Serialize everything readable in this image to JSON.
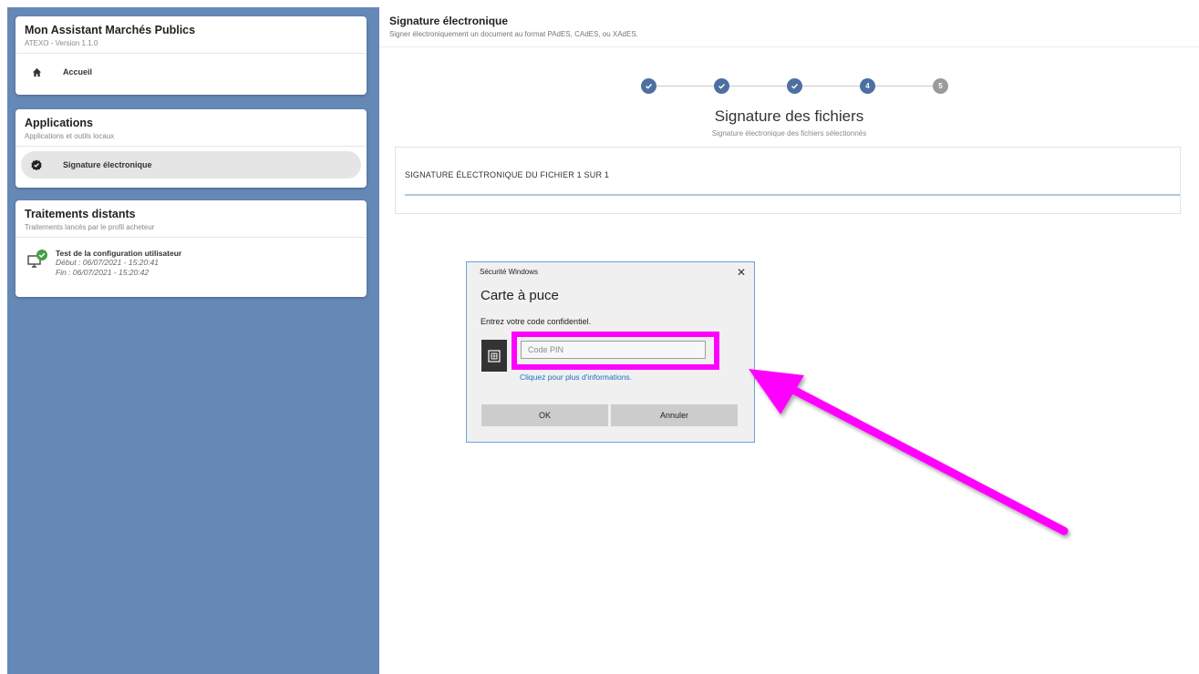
{
  "app": {
    "title": "Mon Assistant Marchés Publics",
    "version": "ATEXO - Version 1.1.0",
    "home_label": "Accueil"
  },
  "applications": {
    "title": "Applications",
    "subtitle": "Applications et outils locaux",
    "items": [
      {
        "label": "Signature électronique",
        "icon": "check-badge-icon",
        "active": true
      }
    ]
  },
  "remote": {
    "title": "Traitements distants",
    "subtitle": "Traitements lancés par le profil acheteur",
    "tasks": [
      {
        "name": "Test de la configuration utilisateur",
        "start": "Début : 06/07/2021 - 15:20:41",
        "end": "Fin : 06/07/2021 - 15:20:42",
        "icon": "monitor-check-icon"
      }
    ]
  },
  "main": {
    "title": "Signature électronique",
    "subtitle": "Signer électroniquement un document au format PAdES, CAdES, ou XAdES.",
    "steps": [
      {
        "state": "done",
        "label": ""
      },
      {
        "state": "done",
        "label": ""
      },
      {
        "state": "done",
        "label": ""
      },
      {
        "state": "current",
        "label": "4"
      },
      {
        "state": "todo",
        "label": "5"
      }
    ],
    "section_title": "Signature des fichiers",
    "section_subtitle": "Signature électronique des fichiers sélectionnés",
    "progress_label": "SIGNATURE ÉLECTRONIQUE DU FICHIER 1 SUR 1",
    "progress_fraction": 1.0
  },
  "dialog": {
    "caption": "Sécurité Windows",
    "title": "Carte à puce",
    "prompt": "Entrez votre code confidentiel.",
    "pin_placeholder": "Code PIN",
    "link": "Cliquez pour plus d'informations.",
    "ok_label": "OK",
    "cancel_label": "Annuler",
    "close_glyph": "✕"
  },
  "colors": {
    "sidebar_bg": "#6588b7",
    "step_active": "#4e6fa2",
    "highlight": "#ff00ff"
  }
}
